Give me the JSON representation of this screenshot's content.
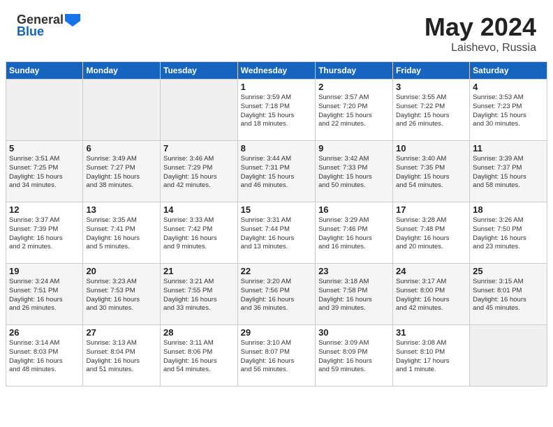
{
  "header": {
    "logo_general": "General",
    "logo_blue": "Blue",
    "title": "May 2024",
    "location": "Laishevo, Russia"
  },
  "calendar": {
    "days_of_week": [
      "Sunday",
      "Monday",
      "Tuesday",
      "Wednesday",
      "Thursday",
      "Friday",
      "Saturday"
    ],
    "weeks": [
      [
        {
          "day": "",
          "info": ""
        },
        {
          "day": "",
          "info": ""
        },
        {
          "day": "",
          "info": ""
        },
        {
          "day": "1",
          "info": "Sunrise: 3:59 AM\nSunset: 7:18 PM\nDaylight: 15 hours\nand 18 minutes."
        },
        {
          "day": "2",
          "info": "Sunrise: 3:57 AM\nSunset: 7:20 PM\nDaylight: 15 hours\nand 22 minutes."
        },
        {
          "day": "3",
          "info": "Sunrise: 3:55 AM\nSunset: 7:22 PM\nDaylight: 15 hours\nand 26 minutes."
        },
        {
          "day": "4",
          "info": "Sunrise: 3:53 AM\nSunset: 7:23 PM\nDaylight: 15 hours\nand 30 minutes."
        }
      ],
      [
        {
          "day": "5",
          "info": "Sunrise: 3:51 AM\nSunset: 7:25 PM\nDaylight: 15 hours\nand 34 minutes."
        },
        {
          "day": "6",
          "info": "Sunrise: 3:49 AM\nSunset: 7:27 PM\nDaylight: 15 hours\nand 38 minutes."
        },
        {
          "day": "7",
          "info": "Sunrise: 3:46 AM\nSunset: 7:29 PM\nDaylight: 15 hours\nand 42 minutes."
        },
        {
          "day": "8",
          "info": "Sunrise: 3:44 AM\nSunset: 7:31 PM\nDaylight: 15 hours\nand 46 minutes."
        },
        {
          "day": "9",
          "info": "Sunrise: 3:42 AM\nSunset: 7:33 PM\nDaylight: 15 hours\nand 50 minutes."
        },
        {
          "day": "10",
          "info": "Sunrise: 3:40 AM\nSunset: 7:35 PM\nDaylight: 15 hours\nand 54 minutes."
        },
        {
          "day": "11",
          "info": "Sunrise: 3:39 AM\nSunset: 7:37 PM\nDaylight: 15 hours\nand 58 minutes."
        }
      ],
      [
        {
          "day": "12",
          "info": "Sunrise: 3:37 AM\nSunset: 7:39 PM\nDaylight: 16 hours\nand 2 minutes."
        },
        {
          "day": "13",
          "info": "Sunrise: 3:35 AM\nSunset: 7:41 PM\nDaylight: 16 hours\nand 5 minutes."
        },
        {
          "day": "14",
          "info": "Sunrise: 3:33 AM\nSunset: 7:42 PM\nDaylight: 16 hours\nand 9 minutes."
        },
        {
          "day": "15",
          "info": "Sunrise: 3:31 AM\nSunset: 7:44 PM\nDaylight: 16 hours\nand 13 minutes."
        },
        {
          "day": "16",
          "info": "Sunrise: 3:29 AM\nSunset: 7:46 PM\nDaylight: 16 hours\nand 16 minutes."
        },
        {
          "day": "17",
          "info": "Sunrise: 3:28 AM\nSunset: 7:48 PM\nDaylight: 16 hours\nand 20 minutes."
        },
        {
          "day": "18",
          "info": "Sunrise: 3:26 AM\nSunset: 7:50 PM\nDaylight: 16 hours\nand 23 minutes."
        }
      ],
      [
        {
          "day": "19",
          "info": "Sunrise: 3:24 AM\nSunset: 7:51 PM\nDaylight: 16 hours\nand 26 minutes."
        },
        {
          "day": "20",
          "info": "Sunrise: 3:23 AM\nSunset: 7:53 PM\nDaylight: 16 hours\nand 30 minutes."
        },
        {
          "day": "21",
          "info": "Sunrise: 3:21 AM\nSunset: 7:55 PM\nDaylight: 16 hours\nand 33 minutes."
        },
        {
          "day": "22",
          "info": "Sunrise: 3:20 AM\nSunset: 7:56 PM\nDaylight: 16 hours\nand 36 minutes."
        },
        {
          "day": "23",
          "info": "Sunrise: 3:18 AM\nSunset: 7:58 PM\nDaylight: 16 hours\nand 39 minutes."
        },
        {
          "day": "24",
          "info": "Sunrise: 3:17 AM\nSunset: 8:00 PM\nDaylight: 16 hours\nand 42 minutes."
        },
        {
          "day": "25",
          "info": "Sunrise: 3:15 AM\nSunset: 8:01 PM\nDaylight: 16 hours\nand 45 minutes."
        }
      ],
      [
        {
          "day": "26",
          "info": "Sunrise: 3:14 AM\nSunset: 8:03 PM\nDaylight: 16 hours\nand 48 minutes."
        },
        {
          "day": "27",
          "info": "Sunrise: 3:13 AM\nSunset: 8:04 PM\nDaylight: 16 hours\nand 51 minutes."
        },
        {
          "day": "28",
          "info": "Sunrise: 3:11 AM\nSunset: 8:06 PM\nDaylight: 16 hours\nand 54 minutes."
        },
        {
          "day": "29",
          "info": "Sunrise: 3:10 AM\nSunset: 8:07 PM\nDaylight: 16 hours\nand 56 minutes."
        },
        {
          "day": "30",
          "info": "Sunrise: 3:09 AM\nSunset: 8:09 PM\nDaylight: 16 hours\nand 59 minutes."
        },
        {
          "day": "31",
          "info": "Sunrise: 3:08 AM\nSunset: 8:10 PM\nDaylight: 17 hours\nand 1 minute."
        },
        {
          "day": "",
          "info": ""
        }
      ]
    ]
  }
}
